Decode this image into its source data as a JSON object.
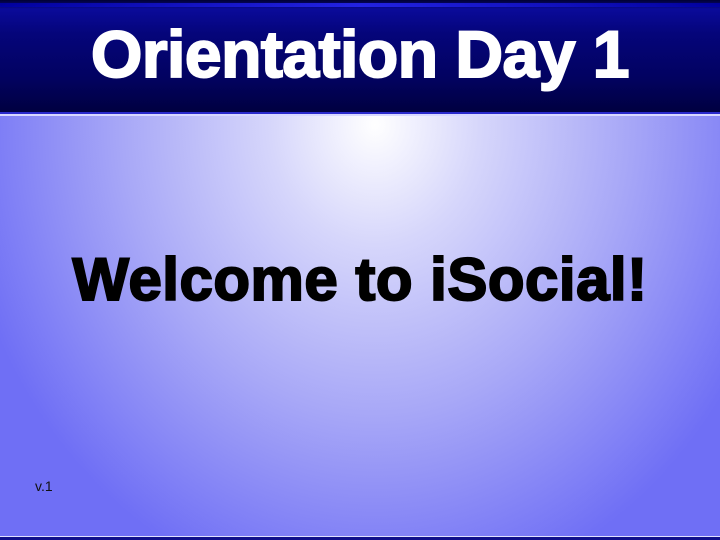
{
  "slide": {
    "title": "Orientation Day 1",
    "subtitle": "Welcome to iSocial!",
    "version": "v.1"
  },
  "colors": {
    "header": "#05057a",
    "text_title": "#ffffff",
    "text_body": "#000000"
  }
}
